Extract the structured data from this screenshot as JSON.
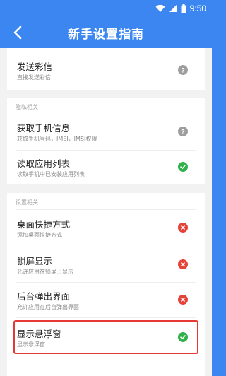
{
  "status_bar": {
    "time": "9:50"
  },
  "app_bar": {
    "title": "新手设置指南",
    "back_icon": "back-arrow-icon"
  },
  "colors": {
    "primary": "#3b86f0",
    "ok": "#2fb24a",
    "bad": "#e5423a",
    "unknown": "#9e9e9e",
    "highlight": "#e53935"
  },
  "sections": [
    {
      "label": "",
      "items": [
        {
          "title": "发送彩信",
          "subtitle": "直接发送彩信",
          "status": "unknown"
        }
      ]
    },
    {
      "label": "隐私相关",
      "items": [
        {
          "title": "获取手机信息",
          "subtitle": "获取手机号码，IMEI，IMSI权限",
          "status": "unknown"
        },
        {
          "title": "读取应用列表",
          "subtitle": "读取手机中已安装应用列表",
          "status": "ok"
        }
      ]
    },
    {
      "label": "设置相关",
      "items": [
        {
          "title": "桌面快捷方式",
          "subtitle": "添加桌面快捷方式",
          "status": "bad"
        },
        {
          "title": "锁屏显示",
          "subtitle": "允许应用在锁屏上显示",
          "status": "bad"
        },
        {
          "title": "后台弹出界面",
          "subtitle": "允许应用在后台弹出界面",
          "status": "bad"
        },
        {
          "title": "显示悬浮窗",
          "subtitle": "显示悬浮窗",
          "status": "ok",
          "highlighted": true
        }
      ]
    }
  ]
}
